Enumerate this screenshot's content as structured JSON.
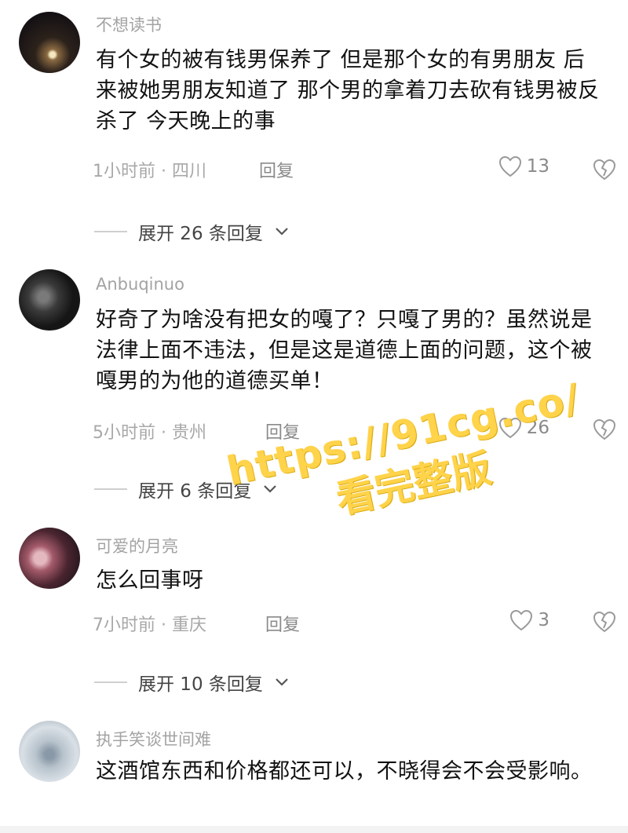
{
  "comments": [
    {
      "username": "不想读书",
      "content": "有个女的被有钱男保养了 但是那个女的有男朋友 后来被她男朋友知道了 那个男的拿着刀去砍有钱男被反杀了 今天晚上的事",
      "meta": "1小时前 · 四川",
      "reply_label": "回复",
      "likes": "13",
      "expand_label": "展开 26 条回复"
    },
    {
      "username": "Anbuqinuo",
      "content": "好奇了为啥没有把女的嘎了？只嘎了男的？虽然说是法律上面不违法，但是这是道德上面的问题，这个被嘎男的为他的道德买单！",
      "meta": "5小时前 · 贵州",
      "reply_label": "回复",
      "likes": "26",
      "expand_label": "展开 6 条回复"
    },
    {
      "username": "可爱的月亮",
      "content": "怎么回事呀",
      "meta": "7小时前 · 重庆",
      "reply_label": "回复",
      "likes": "3",
      "expand_label": "展开 10 条回复"
    },
    {
      "username": "执手笑谈世间难",
      "content": "这酒馆东西和价格都还可以，不晓得会不会受影响。"
    }
  ],
  "watermark": {
    "url": "https://91cg.co/",
    "text": "看完整版"
  },
  "icons": {
    "like": "heart-outline-icon",
    "dislike": "broken-heart-icon",
    "expand": "chevron-down-icon"
  },
  "colors": {
    "watermark": "#ffd34a",
    "username": "#a3a3a3",
    "meta": "#a8a8a8"
  }
}
